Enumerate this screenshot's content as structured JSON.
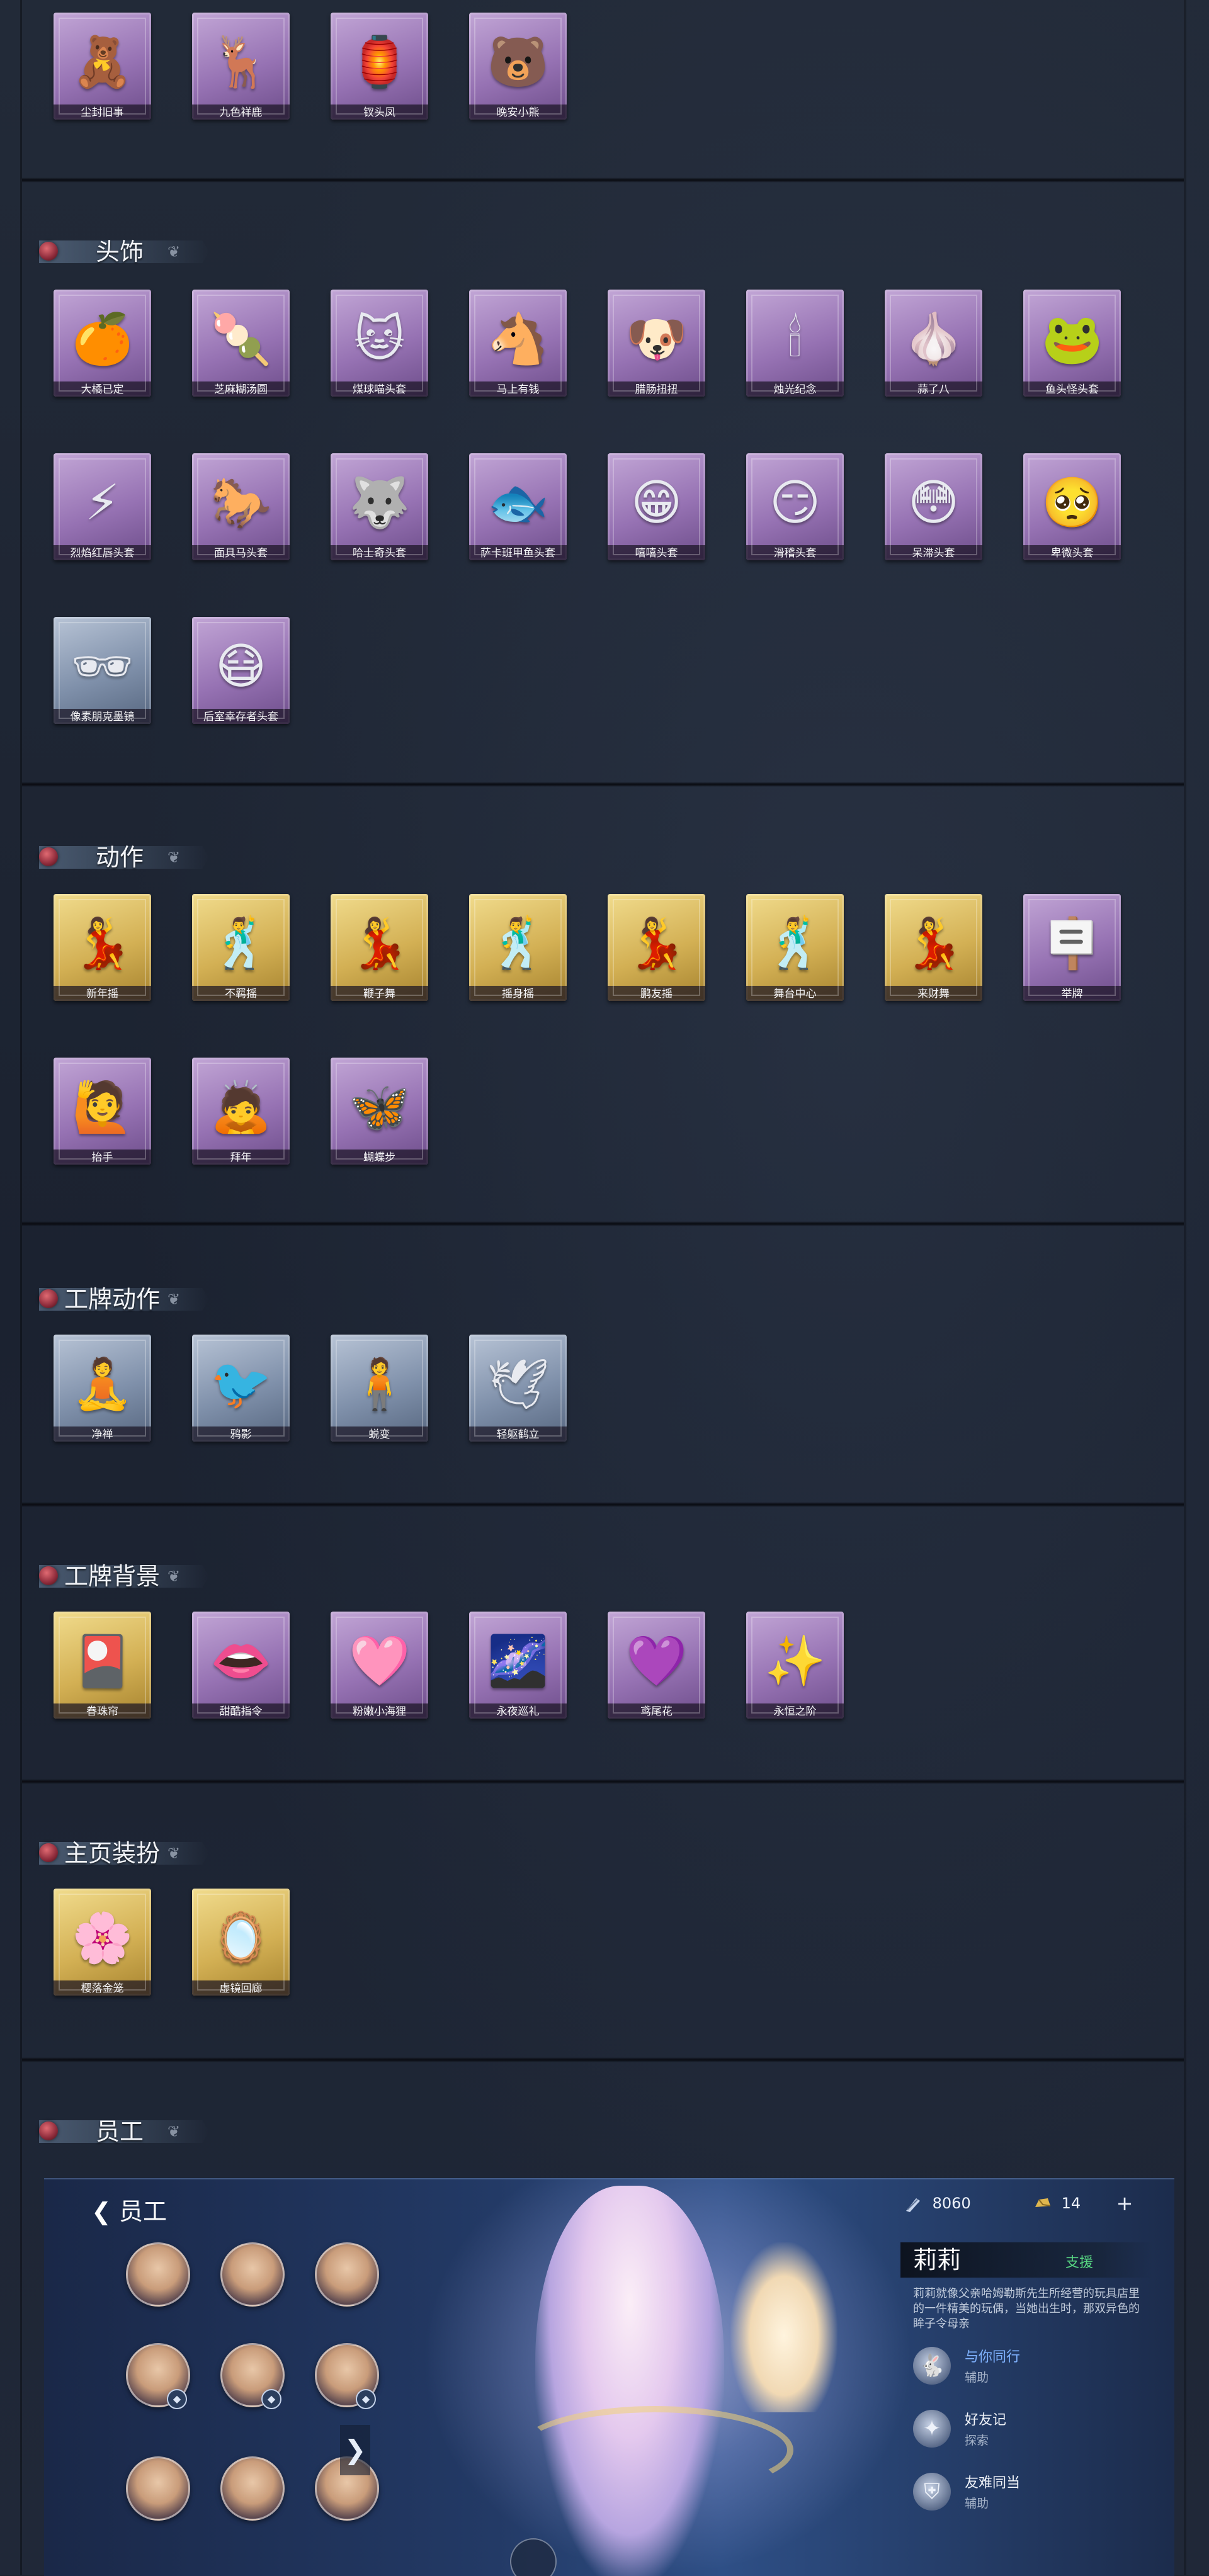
{
  "sections": {
    "top": {
      "items": [
        {
          "label": "尘封旧事",
          "icon": "doll-charm",
          "glyph": "🧸",
          "rarity": "purple"
        },
        {
          "label": "九色祥鹿",
          "icon": "deer-charm",
          "glyph": "🦌",
          "rarity": "purple"
        },
        {
          "label": "钗头凤",
          "icon": "phoenix-charm",
          "glyph": "🏮",
          "rarity": "purple"
        },
        {
          "label": "晚安小熊",
          "icon": "bear-charm",
          "glyph": "🐻",
          "rarity": "purple"
        }
      ]
    },
    "headwear": {
      "title": "头饰",
      "items": [
        {
          "label": "大橘已定",
          "icon": "orange-head",
          "glyph": "🍊",
          "rarity": "purple"
        },
        {
          "label": "芝麻糊汤圆",
          "icon": "dumpling-head",
          "glyph": "🍡",
          "rarity": "purple"
        },
        {
          "label": "煤球喵头套",
          "icon": "cat-head",
          "glyph": "🐱",
          "rarity": "purple"
        },
        {
          "label": "马上有钱",
          "icon": "horse-head",
          "glyph": "🐴",
          "rarity": "purple"
        },
        {
          "label": "腊肠扭扭",
          "icon": "dog-head",
          "glyph": "🐶",
          "rarity": "purple"
        },
        {
          "label": "烛光纪念",
          "icon": "candle-head",
          "glyph": "🕯",
          "rarity": "purple"
        },
        {
          "label": "蒜了八",
          "icon": "garlic-head",
          "glyph": "🧄",
          "rarity": "purple"
        },
        {
          "label": "鱼头怪头套",
          "icon": "fish-head",
          "glyph": "🐸",
          "rarity": "purple"
        },
        {
          "label": "烈焰红唇头套",
          "icon": "pikachu-head",
          "glyph": "⚡",
          "rarity": "purple"
        },
        {
          "label": "面具马头套",
          "icon": "horse-mask",
          "glyph": "🐎",
          "rarity": "purple"
        },
        {
          "label": "哈士奇头套",
          "icon": "husky-head",
          "glyph": "🐺",
          "rarity": "purple"
        },
        {
          "label": "萨卡班甲鱼头套",
          "icon": "fish-mask",
          "glyph": "🐟",
          "rarity": "purple"
        },
        {
          "label": "嘻嘻头套",
          "icon": "grin-head",
          "glyph": "😁",
          "rarity": "purple"
        },
        {
          "label": "滑稽头套",
          "icon": "smirk-head",
          "glyph": "😏",
          "rarity": "purple"
        },
        {
          "label": "呆滞头套",
          "icon": "stare-head",
          "glyph": "😳",
          "rarity": "purple"
        },
        {
          "label": "卑微头套",
          "icon": "humble-head",
          "glyph": "🥺",
          "rarity": "purple"
        },
        {
          "label": "像素朋克墨镜",
          "icon": "pixel-glasses",
          "glyph": "🕶",
          "rarity": "blue"
        },
        {
          "label": "后室幸存者头套",
          "icon": "gasmask-head",
          "glyph": "😷",
          "rarity": "purple"
        }
      ]
    },
    "actions": {
      "title": "动作",
      "items": [
        {
          "label": "新年摇",
          "icon": "dance-pose",
          "glyph": "💃",
          "rarity": "gold"
        },
        {
          "label": "不羁摇",
          "icon": "dance-pose",
          "glyph": "🕺",
          "rarity": "gold"
        },
        {
          "label": "鞭子舞",
          "icon": "dance-pose",
          "glyph": "💃",
          "rarity": "gold"
        },
        {
          "label": "摇身摇",
          "icon": "dance-pose",
          "glyph": "🕺",
          "rarity": "gold"
        },
        {
          "label": "鹏友摇",
          "icon": "dance-pose",
          "glyph": "💃",
          "rarity": "gold"
        },
        {
          "label": "舞台中心",
          "icon": "dance-pose",
          "glyph": "🕺",
          "rarity": "gold"
        },
        {
          "label": "来财舞",
          "icon": "dance-pose",
          "glyph": "💃",
          "rarity": "gold"
        },
        {
          "label": "举牌",
          "icon": "sign-pose",
          "glyph": "🪧",
          "rarity": "purple"
        },
        {
          "label": "抬手",
          "icon": "wave-pose",
          "glyph": "🙋",
          "rarity": "purple"
        },
        {
          "label": "拜年",
          "icon": "bow-pose",
          "glyph": "🙇",
          "rarity": "purple"
        },
        {
          "label": "蝴蝶步",
          "icon": "butterfly-pose",
          "glyph": "🦋",
          "rarity": "purple"
        }
      ]
    },
    "badge_actions": {
      "title": "工牌动作",
      "items": [
        {
          "label": "净禅",
          "icon": "badge-pose",
          "glyph": "🧘",
          "rarity": "blue"
        },
        {
          "label": "鸦影",
          "icon": "badge-pose",
          "glyph": "🐦",
          "rarity": "blue"
        },
        {
          "label": "蜕变",
          "icon": "badge-pose",
          "glyph": "🧍",
          "rarity": "blue"
        },
        {
          "label": "轻躯鹤立",
          "icon": "badge-pose",
          "glyph": "🕊",
          "rarity": "blue"
        }
      ]
    },
    "badge_backgrounds": {
      "title": "工牌背景",
      "items": [
        {
          "label": "眷珠帘",
          "icon": "card-bg",
          "glyph": "🎴",
          "rarity": "gold"
        },
        {
          "label": "甜酷指令",
          "icon": "card-bg",
          "glyph": "👄",
          "rarity": "purple"
        },
        {
          "label": "粉嫩小海狸",
          "icon": "card-bg",
          "glyph": "🩷",
          "rarity": "purple"
        },
        {
          "label": "永夜巡礼",
          "icon": "card-bg",
          "glyph": "🌌",
          "rarity": "purple"
        },
        {
          "label": "鸢尾花",
          "icon": "card-bg",
          "glyph": "💜",
          "rarity": "purple"
        },
        {
          "label": "永恒之阶",
          "icon": "card-bg",
          "glyph": "✨",
          "rarity": "purple"
        }
      ]
    },
    "home_decor": {
      "title": "主页装扮",
      "items": [
        {
          "label": "樱落金笼",
          "icon": "home-decor",
          "glyph": "🌸",
          "rarity": "gold"
        },
        {
          "label": "虚镜回廊",
          "icon": "home-decor",
          "glyph": "🪞",
          "rarity": "gold"
        }
      ]
    },
    "staff": {
      "title": "员工"
    }
  },
  "staff_screen": {
    "back_label": "员工",
    "currency_1": "8060",
    "currency_2": "14",
    "name": "莉莉",
    "role": "支援",
    "description": "莉莉就像父亲哈姆勒斯先生所经营的玩具店里的一件精美的玩偶，当她出生时，那双异色的眸子令母亲",
    "traits": [
      {
        "name": "与你同行",
        "type": "辅助"
      },
      {
        "name": "好友记",
        "type": "探索"
      },
      {
        "name": "友难同当",
        "type": "辅助"
      }
    ]
  },
  "colors": {
    "purple_card": "#9672b3",
    "gold_card": "#d3b054",
    "blue_card": "#7f90aa",
    "role_green": "#58d883",
    "highlight_blue": "#7fb2ff"
  }
}
